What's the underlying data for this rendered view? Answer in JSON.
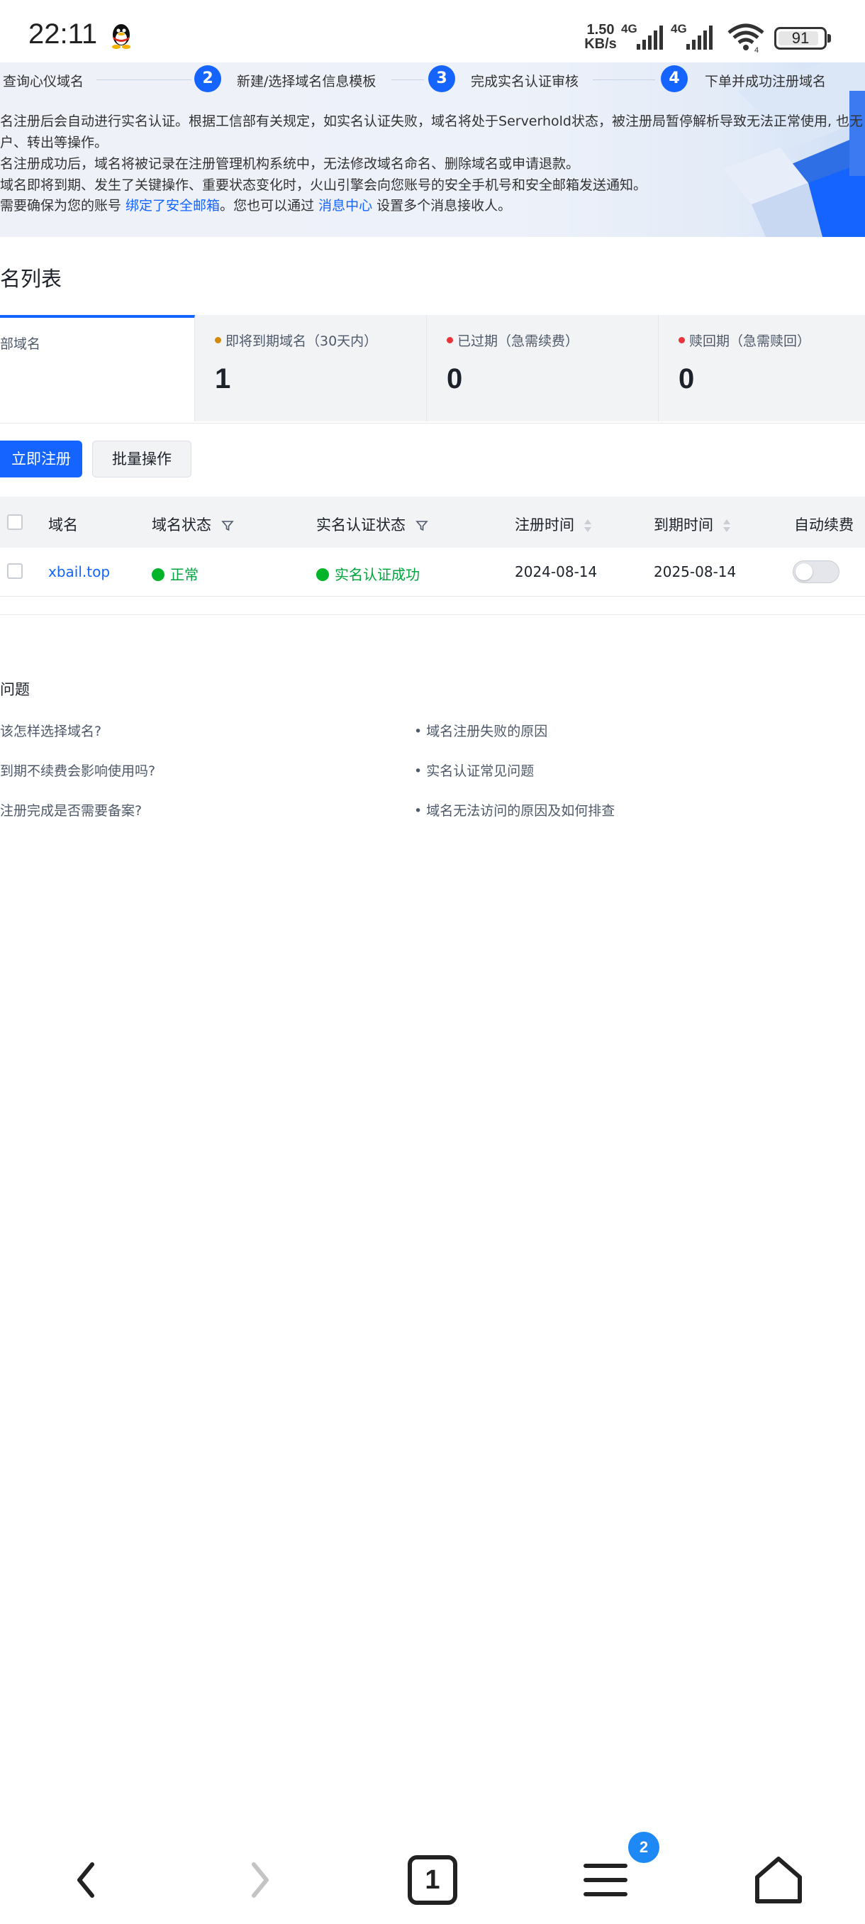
{
  "status_bar": {
    "time": "22:11",
    "net_speed_value": "1.50",
    "net_speed_unit": "KB/s",
    "network_1": "4G",
    "network_2": "4G",
    "battery": "91",
    "battery_level": 0.91
  },
  "steps": [
    {
      "num": "",
      "label": "查询心仪域名"
    },
    {
      "num": "2",
      "label": "新建/选择域名信息模板"
    },
    {
      "num": "3",
      "label": "完成实名认证审核"
    },
    {
      "num": "4",
      "label": "下单并成功注册域名"
    }
  ],
  "notices": {
    "line1": "名注册后会自动进行实名认证。根据工信部有关规定，如实名认证失败，域名将处于Serverhold状态，被注册局暂停解析导致无法正常使用, 也无",
    "line2": "户、转出等操作。",
    "line3": "名注册成功后，域名将被记录在注册管理机构系统中，无法修改域名命名、删除域名或申请退款。",
    "line4": "域名即将到期、发生了关键操作、重要状态变化时，火山引擎会向您账号的安全手机号和安全邮箱发送通知。",
    "line5_prefix": "需要确保为您的账号 ",
    "line5_link1": "绑定了安全邮箱",
    "line5_middle": "。您也可以通过 ",
    "line5_link2": "消息中心",
    "line5_suffix": " 设置多个消息接收人。"
  },
  "section_title": "名列表",
  "summary_cards": [
    {
      "label": "部域名",
      "count": "",
      "dot_color": ""
    },
    {
      "label": "即将到期域名（30天内）",
      "count": "1",
      "dot_color": "#d4890a"
    },
    {
      "label": "已过期（急需续费）",
      "count": "0",
      "dot_color": "#e8343a"
    },
    {
      "label": "赎回期（急需赎回）",
      "count": "0",
      "dot_color": "#e8343a"
    }
  ],
  "actions": {
    "register": "立即注册",
    "batch": "批量操作"
  },
  "table": {
    "headers": {
      "domain": "域名",
      "domain_status": "域名状态",
      "verify_status": "实名认证状态",
      "reg_time": "注册时间",
      "exp_time": "到期时间",
      "auto_renew": "自动续费"
    },
    "rows": [
      {
        "domain": "xbail.top",
        "domain_status": "正常",
        "verify_status": "实名认证成功",
        "reg_time": "2024-08-14",
        "exp_time": "2025-08-14",
        "auto_renew": false
      }
    ]
  },
  "faq": {
    "title": "问题",
    "items": [
      "该怎样选择域名?",
      "到期不续费会影响使用吗?",
      "注册完成是否需要备案?",
      "• 域名注册失败的原因",
      "• 实名认证常见问题",
      "• 域名无法访问的原因及如何排查"
    ]
  },
  "bottom_nav": {
    "tabs_count": "1",
    "menu_badge": "2"
  },
  "colors": {
    "accent": "#1664ff",
    "success": "#00b42a",
    "warning": "#d4890a",
    "danger": "#e8343a"
  }
}
